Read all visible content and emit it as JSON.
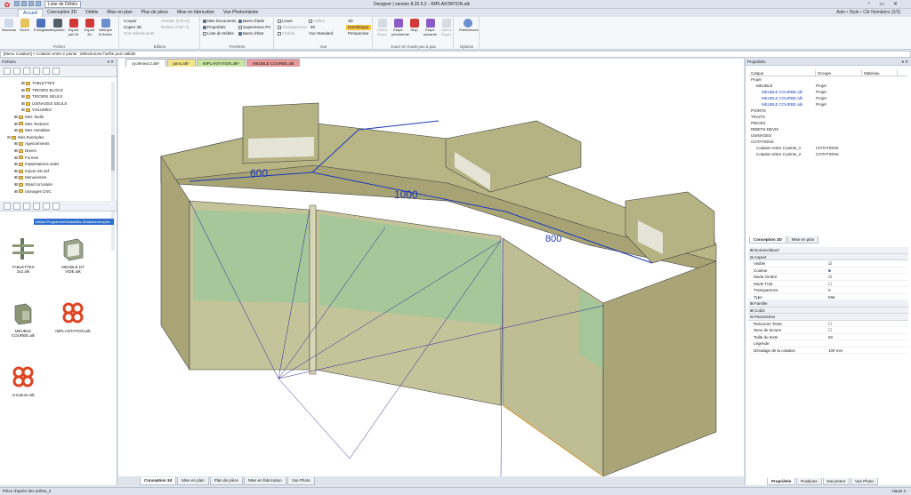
{
  "titlebar": {
    "quick_title": "Liste de Débits",
    "window_title": "Designer | version 8.25.5.2 - IMPLANTATION.alk",
    "win_min": "–",
    "win_max": "▭",
    "win_close": "✕"
  },
  "menu": {
    "tabs": [
      "Accueil",
      "Conception 3D",
      "Débits",
      "Mise en plan",
      "Plan de pièce",
      "Mise en fabrication",
      "Vue Photoréaliste"
    ]
  },
  "topright": {
    "help": "Aide",
    "style": "Style",
    "user": "Clé Nombiers (2/2)"
  },
  "ribbon": {
    "fichier": {
      "label": "Fichier",
      "buttons": [
        "Nouveau",
        "Ouvrir",
        "Enregistrer",
        "Imprimer",
        "Export pdf 2d",
        "Export 3d",
        "Nettoyer le fichier"
      ]
    },
    "edition": {
      "label": "Édition",
      "items": [
        "Couper",
        "Copier 3D",
        "Tout Sélectionner",
        "Annuler (Ctrl+Z)",
        "Refaire (Ctrl+Y)"
      ]
    },
    "fenetres": {
      "label": "Fenêtres",
      "items": [
        {
          "t": "Mes Documents",
          "on": true
        },
        {
          "t": "Propriétés",
          "on": true
        },
        {
          "t": "Liste de Débits",
          "on": false
        },
        {
          "t": "Barre d'aide",
          "on": true
        },
        {
          "t": "Superviseur PC",
          "on": false
        },
        {
          "t": "Barre d'état",
          "on": true
        }
      ]
    },
    "vue": {
      "label": "Vue",
      "items": [
        "Lisser",
        "Transparence",
        "Chaîne",
        "Arêtes",
        "Vue Standard",
        "3D",
        "Isométrique",
        "Perspective"
      ],
      "opacity": "50"
    },
    "pas": {
      "label": "Jouer en mode pas à pas",
      "buttons": [
        "Début Étape",
        "Étape précédente",
        "Stop",
        "Étape suivante",
        "Début Étape"
      ]
    },
    "options": {
      "label": "Options",
      "button": "Préférences"
    }
  },
  "cmdline": "[Menu Cotation] > Cotation entre 2 points : Sélectionner l'arête puis Valider",
  "left": {
    "header": "Fichiers",
    "tree": [
      "TABLETTES",
      "TIROIRS BLOCS",
      "TIROIRS SEULS",
      "USINAGES SEULS",
      "VOLUMES",
      "Mes Taxifs",
      "Mes Textures",
      "Mes Variables",
      "Mes Exemples",
      "Agencements",
      "Divers",
      "Formes",
      "Implantations vides",
      "Import 2D dxf",
      "Menuiseries",
      "Stand circulaire",
      "Usinages CNC"
    ],
    "path": "lsAlkis.Programme\\DataAlkis.3Dalkis\\exemples",
    "thumbs": [
      "TABLETTES 3x2.alk",
      "MEUBLE DT VIDE.alk",
      "MEUBLE COURBE.alk",
      "IMPLANTATION.alk",
      "Armature.alk"
    ]
  },
  "doc_tabs": [
    "cyclemed 2.alk*",
    "jams.alk*",
    "IMPLANTATION.alk*",
    "MEUBLE COURBE.alk"
  ],
  "view_tabs": [
    "Conception 3d",
    "Mise en plan",
    "Plan de pièce",
    "Mise en fabrication",
    "Vue Photo"
  ],
  "dims": [
    "600",
    "1000",
    "800"
  ],
  "right": {
    "header": "Propriétés",
    "cols": [
      "Calque",
      "Groupe",
      "Matériau"
    ],
    "rows": [
      {
        "n": "Projet",
        "g": "",
        "b": false,
        "ind": 0
      },
      {
        "n": "MEUBLE",
        "g": "Projet",
        "b": false,
        "ind": 1
      },
      {
        "n": "MEUBLE COURBE.alk",
        "g": "Projet",
        "b": true,
        "ind": 2
      },
      {
        "n": "MEUBLE COURBE.alk",
        "g": "Projet",
        "b": true,
        "ind": 2
      },
      {
        "n": "MEUBLE COURBE.alk",
        "g": "Projet",
        "b": true,
        "ind": 2
      },
      {
        "n": "POINTS",
        "g": "",
        "b": false,
        "ind": 0
      },
      {
        "n": "TRAITS",
        "g": "",
        "b": false,
        "ind": 0
      },
      {
        "n": "PIECES",
        "g": "",
        "b": false,
        "ind": 0
      },
      {
        "n": "DEBITS-DEVIS",
        "g": "",
        "b": false,
        "ind": 0
      },
      {
        "n": "USINAGES",
        "g": "",
        "b": false,
        "ind": 0
      },
      {
        "n": "COTATIONS",
        "g": "",
        "b": false,
        "ind": 0
      },
      {
        "n": "Cotation entre 2 points_1",
        "g": "COTATIONS",
        "b": false,
        "ind": 1
      },
      {
        "n": "Cotation entre 2 points_2",
        "g": "COTATIONS",
        "b": false,
        "ind": 1
      }
    ],
    "tabs": [
      "Conception 3D",
      "Mise en plan"
    ],
    "sections": {
      "nom": "Nomenclature",
      "aspect": "Aspect",
      "famille": "Famille",
      "couts": "Coûts",
      "params": "Paramètres"
    },
    "aspect": [
      {
        "k": "Visible",
        "v": "☑"
      },
      {
        "k": "Couleur",
        "v": "■"
      },
      {
        "k": "Mode Ombré",
        "v": "☑"
      },
      {
        "k": "Mode Trait",
        "v": "☐"
      },
      {
        "k": "Transparence",
        "v": "0"
      },
      {
        "k": "Type",
        "v": "Mat"
      }
    ],
    "params": [
      {
        "k": "Retourner Texte",
        "v": "☐"
      },
      {
        "k": "Sens de lecture",
        "v": "☐"
      },
      {
        "k": "Taille du texte",
        "v": "50"
      },
      {
        "k": "Légende",
        "v": ""
      },
      {
        "k": "Décalage de la cotation",
        "v": "100 mm"
      }
    ],
    "bottom_tabs": [
      "Propriétés",
      "Positions",
      "Document",
      "Vue Photo"
    ]
  },
  "status": {
    "left": "Pièce d'après des arêtes_2",
    "right": "Hauts 2"
  }
}
